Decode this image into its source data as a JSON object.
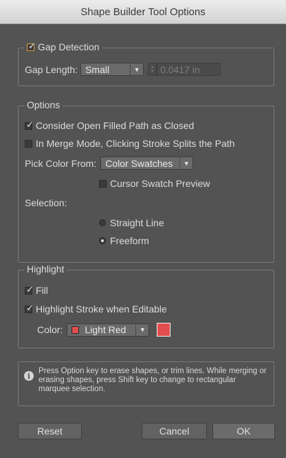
{
  "window": {
    "title": "Shape Builder Tool Options"
  },
  "gap_detection": {
    "label": "Gap Detection",
    "checked": true,
    "length_label": "Gap Length:",
    "length_value": "Small",
    "custom_value": "0.0417 in"
  },
  "options": {
    "legend": "Options",
    "open_filled": {
      "label": "Consider Open Filled Path as Closed",
      "checked": true
    },
    "merge_mode": {
      "label": "In Merge Mode, Clicking Stroke Splits the Path",
      "checked": false
    },
    "pick_color_label": "Pick Color From:",
    "pick_color_value": "Color Swatches",
    "cursor_preview": {
      "label": "Cursor Swatch Preview",
      "checked": false
    },
    "selection_label": "Selection:",
    "straight_line": {
      "label": "Straight Line",
      "selected": false
    },
    "freeform": {
      "label": "Freeform",
      "selected": true
    }
  },
  "highlight": {
    "legend": "Highlight",
    "fill": {
      "label": "Fill",
      "checked": true
    },
    "stroke": {
      "label": "Highlight Stroke when Editable",
      "checked": true
    },
    "color_label": "Color:",
    "color_value": "Light Red",
    "color_hex": "#e24e4e"
  },
  "info": {
    "text": "Press Option key to erase shapes, or trim lines. While merging or erasing shapes, press Shift key to change to rectangular marquee selection."
  },
  "buttons": {
    "reset": "Reset",
    "cancel": "Cancel",
    "ok": "OK"
  },
  "icons": {
    "info": "info-icon",
    "dropdown": "chevron-down-icon"
  }
}
